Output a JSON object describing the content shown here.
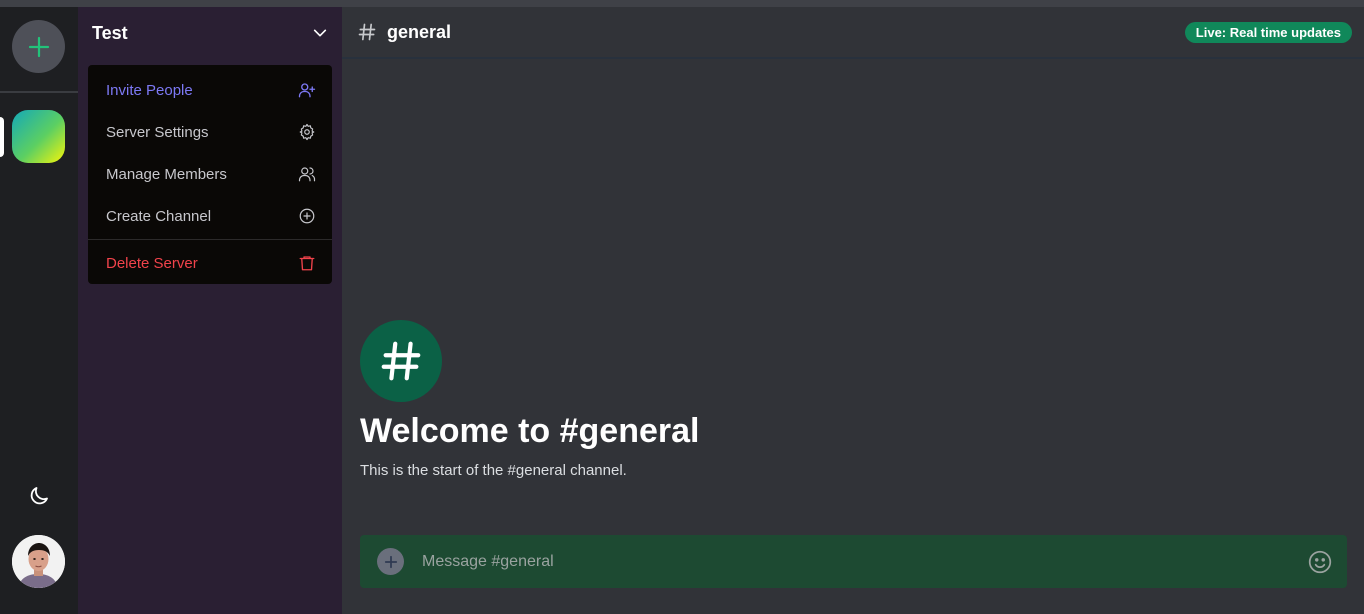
{
  "server": {
    "name": "Test"
  },
  "menu": {
    "invite": "Invite People",
    "settings": "Server Settings",
    "members": "Manage Members",
    "create_channel": "Create Channel",
    "delete": "Delete Server"
  },
  "channel": {
    "name": "general",
    "live_badge": "Live: Real time updates",
    "welcome_title": "Welcome to #general",
    "welcome_subtitle": "This is the start of the #general channel."
  },
  "composer": {
    "placeholder": "Message #general"
  },
  "colors": {
    "invite": "#7d79f5",
    "danger": "#f1434b",
    "live_badge": "#10885a",
    "welcome_icon_bg": "#0b6146",
    "composer_bg": "#1d4a32"
  }
}
